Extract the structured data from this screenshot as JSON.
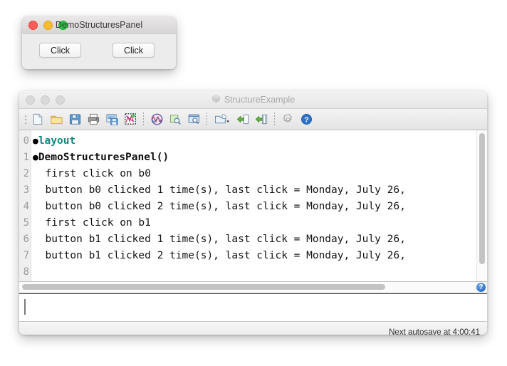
{
  "windows": {
    "demo": {
      "title": "DemoStructuresPanel",
      "traffic_lights": [
        "close-red",
        "minimize-yellow",
        "zoom-green"
      ],
      "buttons": [
        {
          "label": "Click",
          "name": "b0"
        },
        {
          "label": "Click",
          "name": "b1"
        }
      ]
    },
    "structure": {
      "title": "StructureExample",
      "title_icon": "cube-icon",
      "traffic_lights": [
        "close-gray",
        "minimize-gray",
        "zoom-gray"
      ],
      "toolbar": {
        "groups": [
          {
            "items": [
              {
                "icon": "new-document-icon",
                "label": "New"
              },
              {
                "icon": "open-folder-icon",
                "label": "Open"
              },
              {
                "icon": "save-floppy-icon",
                "label": "Save"
              },
              {
                "icon": "print-icon",
                "label": "Print"
              },
              {
                "icon": "save-image-icon",
                "label": "Save Image"
              },
              {
                "icon": "new-plot-icon",
                "label": "New Plot"
              }
            ]
          },
          {
            "items": [
              {
                "icon": "waveform-circle-icon",
                "label": "Signal"
              },
              {
                "icon": "zoom-region-icon",
                "label": "Zoom Region"
              },
              {
                "icon": "zoom-window-icon",
                "label": "Zoom Window"
              }
            ]
          },
          {
            "items": [
              {
                "icon": "new-window-dropdown-icon",
                "label": "New Window"
              },
              {
                "icon": "insert-left-icon",
                "label": "Insert"
              },
              {
                "icon": "insert-column-icon",
                "label": "Insert Column"
              }
            ]
          },
          {
            "items": [
              {
                "icon": "gear-icon",
                "label": "Preferences"
              },
              {
                "icon": "help-circle-icon",
                "label": "Help"
              }
            ]
          }
        ]
      },
      "editor": {
        "line_numbers": [
          "0",
          "1",
          "2",
          "3",
          "4",
          "5",
          "6",
          "7",
          "8"
        ],
        "lines": [
          {
            "bullet": true,
            "indent": false,
            "text": "layout",
            "style": "teal"
          },
          {
            "bullet": true,
            "indent": false,
            "text": "DemoStructuresPanel()",
            "style": "bold"
          },
          {
            "bullet": false,
            "indent": true,
            "text": "first click on b0",
            "style": "plain"
          },
          {
            "bullet": false,
            "indent": true,
            "text": "button b0 clicked 1 time(s), last click = Monday, July 26,",
            "style": "plain"
          },
          {
            "bullet": false,
            "indent": true,
            "text": "button b0 clicked 2 time(s), last click = Monday, July 26,",
            "style": "plain"
          },
          {
            "bullet": false,
            "indent": true,
            "text": "first click on b1",
            "style": "plain"
          },
          {
            "bullet": false,
            "indent": true,
            "text": "button b1 clicked 1 time(s), last click = Monday, July 26,",
            "style": "plain"
          },
          {
            "bullet": false,
            "indent": true,
            "text": "button b1 clicked 2 time(s), last click = Monday, July 26,",
            "style": "plain"
          },
          {
            "bullet": false,
            "indent": true,
            "text": "",
            "style": "plain"
          }
        ]
      },
      "scroll_help_badge": "?",
      "command_input": {
        "value": "",
        "placeholder": ""
      },
      "status": {
        "autosave_text": "Next autosave at 4:00:41"
      }
    }
  },
  "colors": {
    "teal_keyword": "#0e8a80",
    "help_blue": "#2f73c9",
    "window_chrome": "#ececec",
    "light_red": "#ff5f57",
    "light_yellow": "#ffbd2e",
    "light_green": "#28c840"
  }
}
